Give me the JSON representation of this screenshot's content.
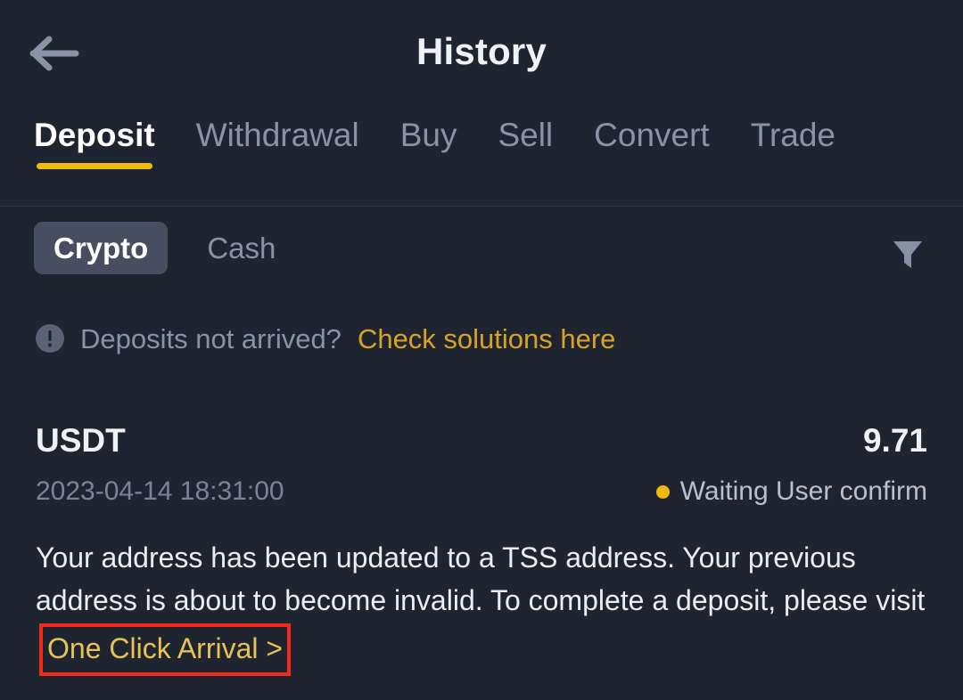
{
  "header": {
    "title": "History",
    "back_icon": "arrow-left-icon"
  },
  "tabs": [
    {
      "label": "Deposit",
      "active": true
    },
    {
      "label": "Withdrawal",
      "active": false
    },
    {
      "label": "Buy",
      "active": false
    },
    {
      "label": "Sell",
      "active": false
    },
    {
      "label": "Convert",
      "active": false
    },
    {
      "label": "Trade",
      "active": false
    }
  ],
  "segments": [
    {
      "label": "Crypto",
      "active": true
    },
    {
      "label": "Cash",
      "active": false
    }
  ],
  "filter": {
    "icon": "filter-funnel-icon"
  },
  "notice": {
    "icon": "exclamation-circle-icon",
    "text": "Deposits not arrived?",
    "link": "Check solutions here"
  },
  "transaction": {
    "asset": "USDT",
    "amount": "9.71",
    "date": "2023-04-14 18:31:00",
    "status": "Waiting User confirm",
    "status_color": "#f0b90b",
    "message_part1": "Your address has been updated to a TSS address. Your previous address is about to become invalid. To complete a deposit, please visit",
    "message_link": "One Click Arrival >"
  },
  "colors": {
    "background": "#1e2530",
    "accent": "#f0b90b",
    "link": "#d8a227",
    "muted_text": "#8a93a5",
    "segment_active_bg": "#474e60",
    "highlight_box": "#f02b1d"
  }
}
